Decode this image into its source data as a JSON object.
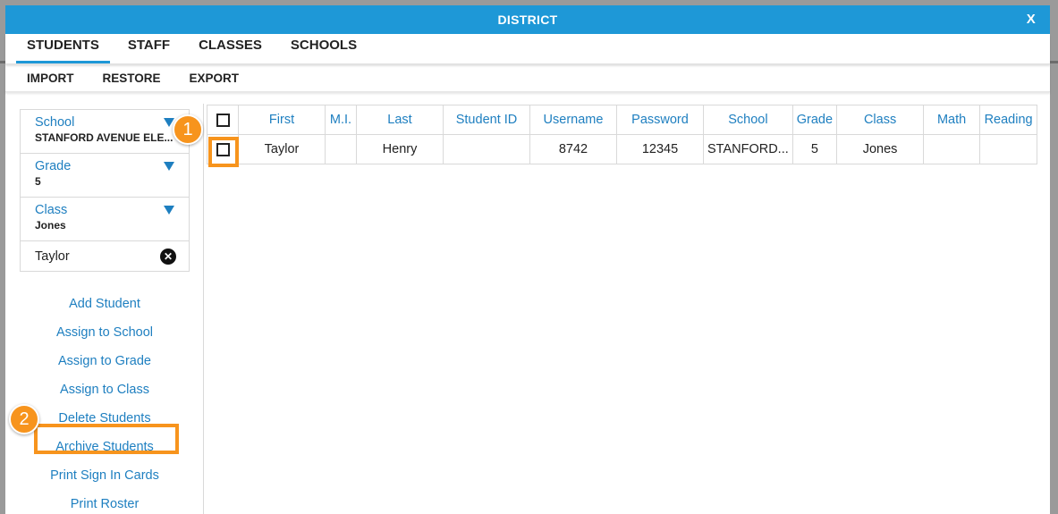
{
  "window": {
    "title": "DISTRICT",
    "close_label": "X"
  },
  "tabs": [
    {
      "label": "STUDENTS",
      "active": true
    },
    {
      "label": "STAFF"
    },
    {
      "label": "CLASSES"
    },
    {
      "label": "SCHOOLS"
    }
  ],
  "subtabs": [
    "IMPORT",
    "RESTORE",
    "EXPORT"
  ],
  "filters": [
    {
      "label": "School",
      "value": "STANFORD AVENUE ELE..."
    },
    {
      "label": "Grade",
      "value": "5"
    },
    {
      "label": "Class",
      "value": "Jones"
    }
  ],
  "search": {
    "value": "Taylor"
  },
  "actions": [
    "Add Student",
    "Assign to School",
    "Assign to Grade",
    "Assign to Class",
    "Delete Students",
    "Archive Students",
    "Print Sign In Cards",
    "Print Roster"
  ],
  "table": {
    "columns": [
      "First",
      "M.I.",
      "Last",
      "Student ID",
      "Username",
      "Password",
      "School",
      "Grade",
      "Class",
      "Math",
      "Reading"
    ],
    "rows": [
      [
        "Taylor",
        "",
        "Henry",
        "",
        "8742",
        "12345",
        "STANFORD...",
        "5",
        "Jones",
        "",
        ""
      ]
    ]
  },
  "callouts": {
    "step1": "1",
    "step2": "2"
  },
  "colors": {
    "accent": "#1e98d7",
    "link": "#1e7fc0",
    "highlight": "#f7941d"
  }
}
